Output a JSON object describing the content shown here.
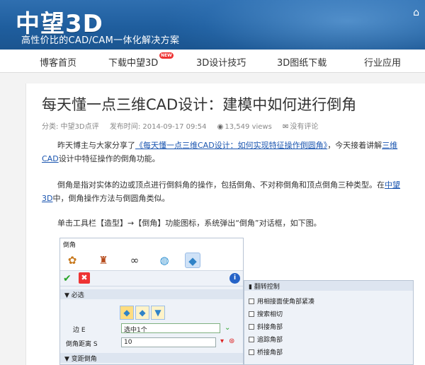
{
  "header": {
    "logo_text": "中望3D",
    "tagline": "高性价比的CAD/CAM一体化解决方案",
    "home_icon": "home-icon"
  },
  "nav": {
    "items": [
      {
        "label": "博客首页"
      },
      {
        "label": "下载中望3D",
        "badge": "NEW"
      },
      {
        "label": "3D设计技巧"
      },
      {
        "label": "3D图纸下载"
      },
      {
        "label": "行业应用"
      }
    ]
  },
  "article": {
    "title": "每天懂一点三维CAD设计：建模中如何进行倒角",
    "meta": {
      "category": "分类: 中望3D点评",
      "published": "发布时间: 2014-09-17 09:54",
      "views": "13,549 views",
      "comments": "没有评论"
    },
    "p1_a": "昨天博主与大家分享了",
    "p1_link": "《每天懂一点三维CAD设计：如何实现特征操作倒圆角》",
    "p1_b": "，今天接着讲解",
    "p1_link2": "三维CAD",
    "p1_c": "设计中特征操作的倒角功能。",
    "p2_a": "倒角是指对实体的边或顶点进行倒斜角的操作，包括倒角、不对称倒角和顶点倒角三种类型。在",
    "p2_link": "中望3D",
    "p2_b": "中，倒角操作方法与倒圆角类似。",
    "p3": "单击工具栏【造型】→【倒角】功能图标，系统弹出“倒角”对话框，如下图。"
  },
  "dialog": {
    "title": "倒角",
    "section_required": "▼ 必选",
    "edge_label": "边 E",
    "edge_value": "选中1个",
    "distance_label": "倒角距离 S",
    "distance_value": "10",
    "section_variable": "▼ 变距倒角",
    "side_title": "▮ 翻转控制",
    "options": [
      "用相接面使角部紧凑",
      "搜索相切",
      "斜接角部",
      "追踪角部",
      "桥接角部"
    ]
  }
}
